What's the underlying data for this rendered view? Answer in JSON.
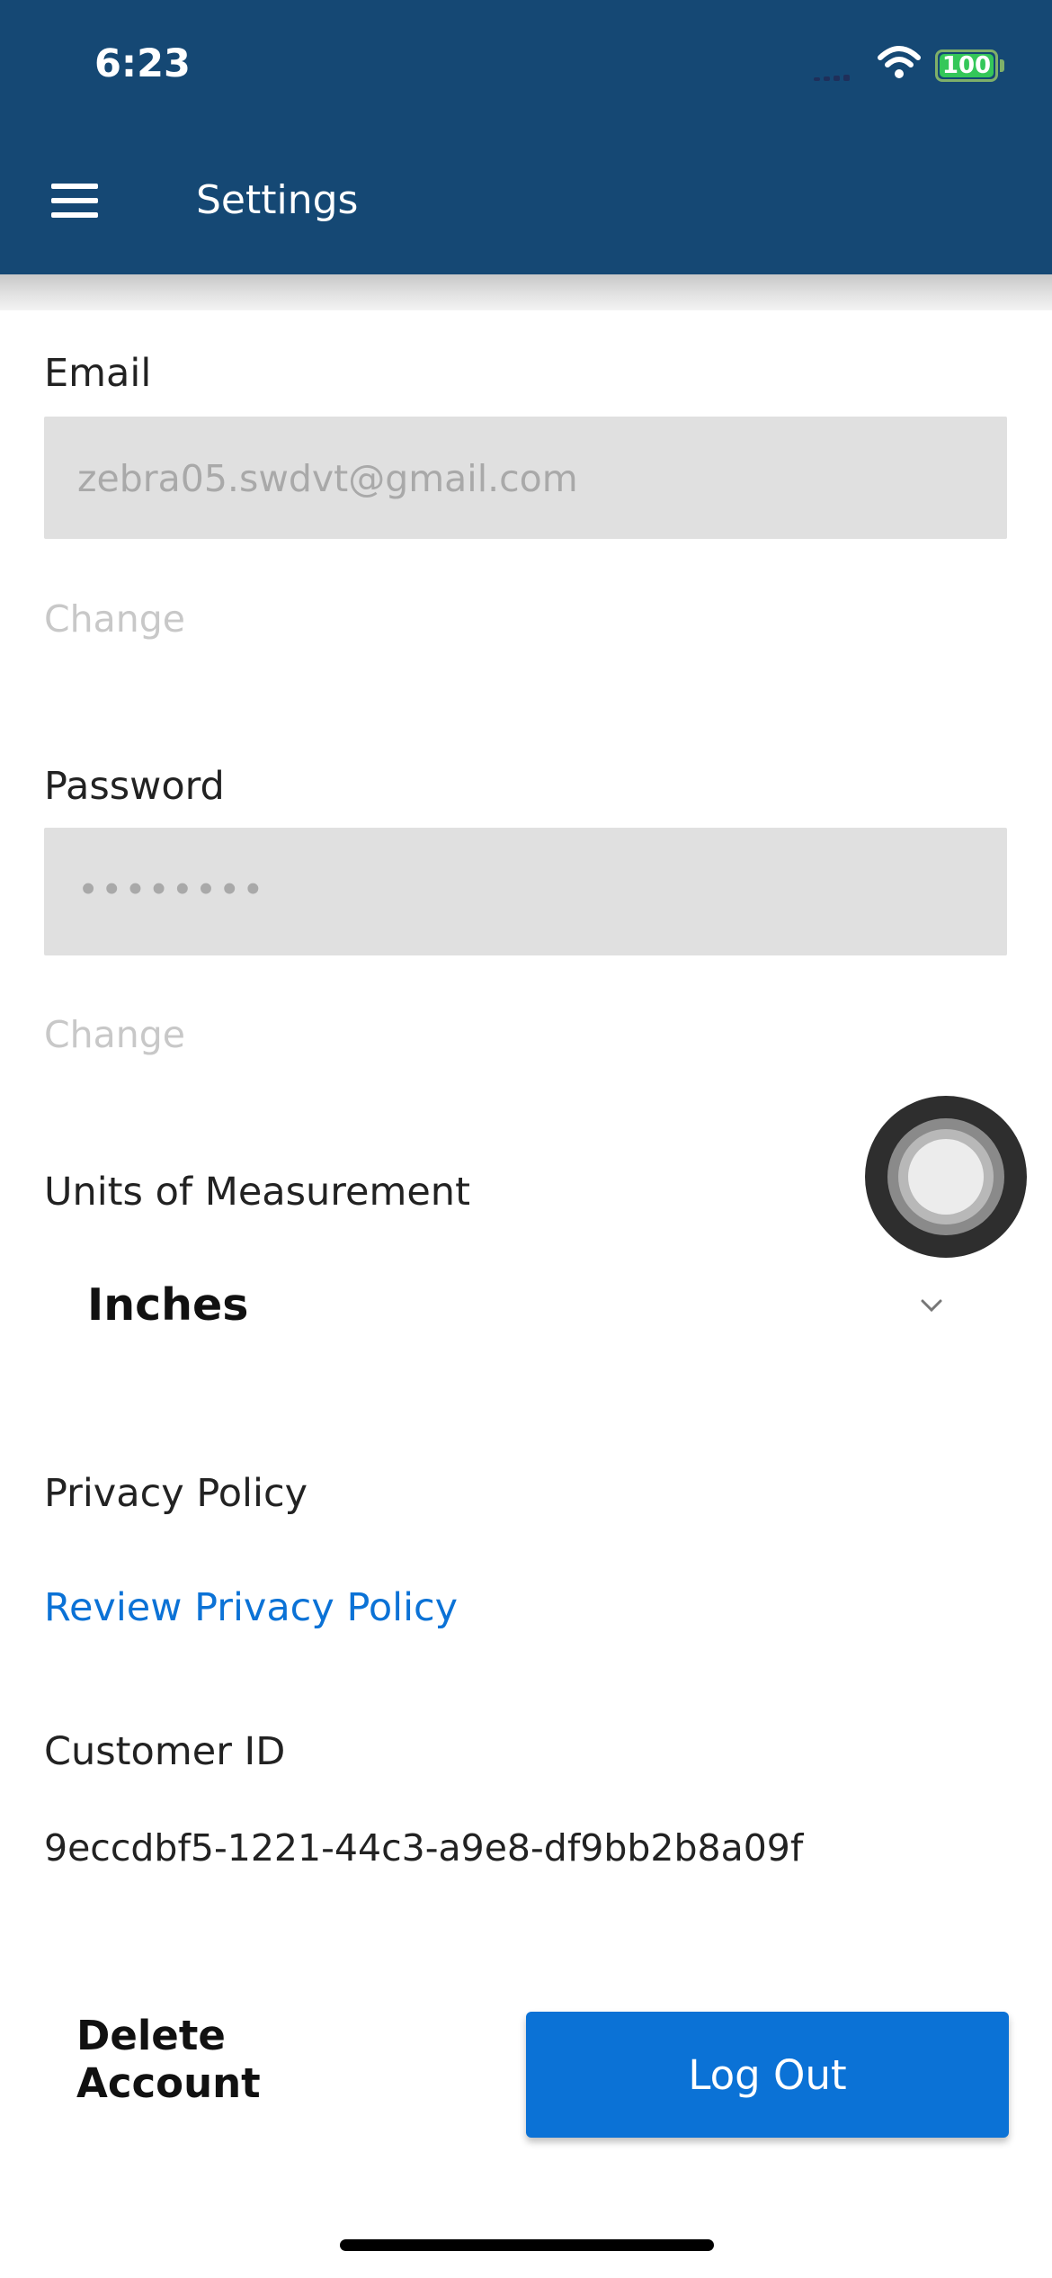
{
  "status_bar": {
    "time": "6:23",
    "battery": "100"
  },
  "header": {
    "title": "Settings"
  },
  "email": {
    "label": "Email",
    "value": "zebra05.swdvt@gmail.com",
    "change": "Change"
  },
  "password": {
    "label": "Password",
    "value": "••••••••",
    "change": "Change"
  },
  "units": {
    "label": "Units of Measurement",
    "selected": "Inches"
  },
  "privacy": {
    "label": "Privacy Policy",
    "link": "Review Privacy Policy"
  },
  "customer": {
    "label": "Customer ID",
    "id": "9eccdbf5-1221-44c3-a9e8-df9bb2b8a09f"
  },
  "actions": {
    "delete": "Delete Account",
    "logout": "Log Out"
  },
  "colors": {
    "header": "#154874",
    "accent": "#0b72d6"
  }
}
